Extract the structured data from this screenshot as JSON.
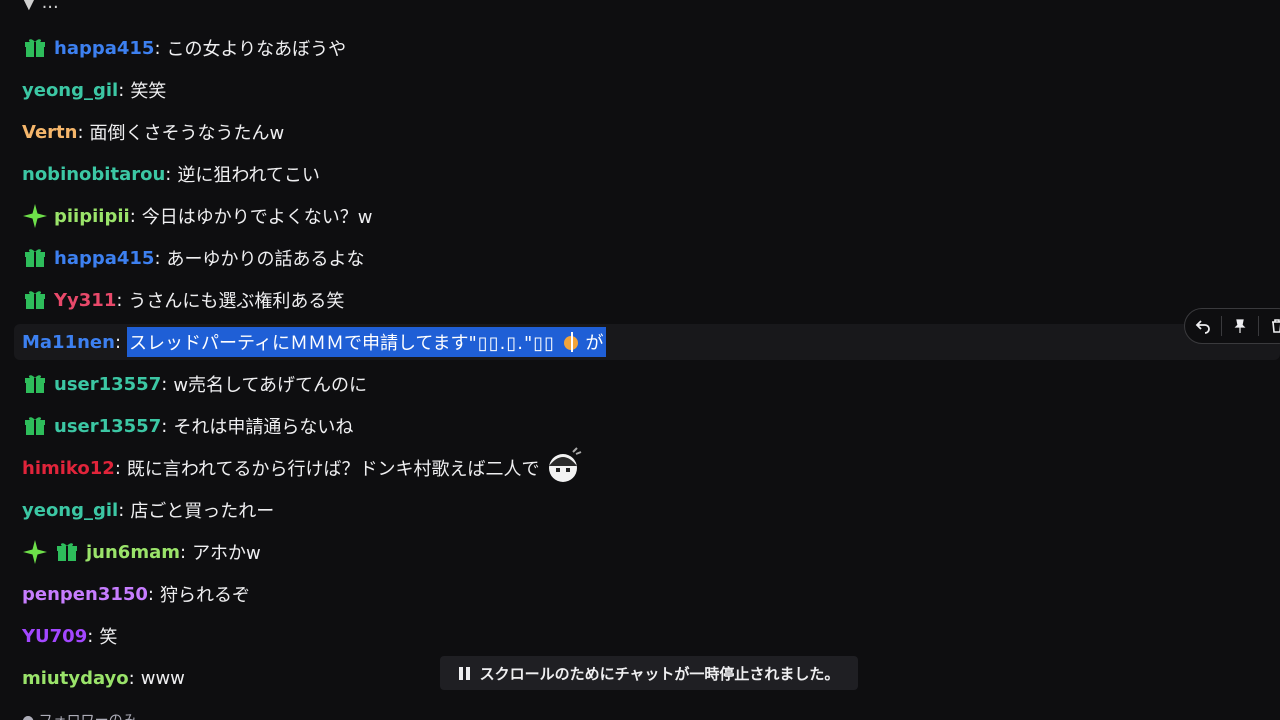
{
  "colors": {
    "gift_badge": "#2ebd5b",
    "sparkle_badge": "#6ee04a",
    "selection": "#1f5fd6"
  },
  "top_partial": "▼ ...",
  "messages": [
    {
      "user": "happa415",
      "color": "#3d80f0",
      "badges": [
        "gift-icon"
      ],
      "text": "この女よりなあぼうや"
    },
    {
      "user": "yeong_gil",
      "color": "#3cc7a4",
      "badges": [],
      "text": "笑笑"
    },
    {
      "user": "Vertn",
      "color": "#f5b66b",
      "badges": [],
      "text": "面倒くさそうなうたんw"
    },
    {
      "user": "nobinobitarou",
      "color": "#3cc7a4",
      "badges": [],
      "text": "逆に狙われてこい"
    },
    {
      "user": "piipiipii",
      "color": "#9ae36a",
      "badges": [
        "sparkle-icon"
      ],
      "text": "今日はゆかりでよくない？w"
    },
    {
      "user": "happa415",
      "color": "#3d80f0",
      "badges": [
        "gift-icon"
      ],
      "text": "あーゆかりの話あるよな"
    },
    {
      "user": "Yy311",
      "color": "#e8496a",
      "badges": [
        "gift-icon"
      ],
      "text": "うさんにも選ぶ権利ある笑"
    },
    {
      "user": "Ma11nen",
      "color": "#3d80f0",
      "badges": [],
      "text": "スレッドパーティにＭＭＭで申請してます",
      "selected": true,
      "tail": "が"
    },
    {
      "user": "user13557",
      "color": "#3cc7a4",
      "badges": [
        "gift-icon"
      ],
      "text": "w売名してあげてんのに"
    },
    {
      "user": "user13557",
      "color": "#3cc7a4",
      "badges": [
        "gift-icon"
      ],
      "text": "それは申請通らないね"
    },
    {
      "user": "himiko12",
      "color": "#e0243a",
      "badges": [],
      "text": "既に言われてるから行けば？ドンキ村歌えば二人で",
      "emote": true
    },
    {
      "user": "yeong_gil",
      "color": "#3cc7a4",
      "badges": [],
      "text": "店ごと買ったれー"
    },
    {
      "user": "jun6mam",
      "color": "#9ae36a",
      "badges": [
        "sparkle-icon",
        "gift-icon"
      ],
      "text": "アホかw"
    },
    {
      "user": "penpen3150",
      "color": "#c77dff",
      "badges": [],
      "text": "狩られるぞ"
    },
    {
      "user": "YU709",
      "color": "#a347ff",
      "badges": [],
      "text": "笑"
    },
    {
      "user": "miutydayo",
      "color": "#9ae36a",
      "badges": [],
      "text": "www"
    }
  ],
  "paused_notice": "スクロールのためにチャットが一時停止されました。",
  "bottom_partial": "● フォロワーのみ"
}
